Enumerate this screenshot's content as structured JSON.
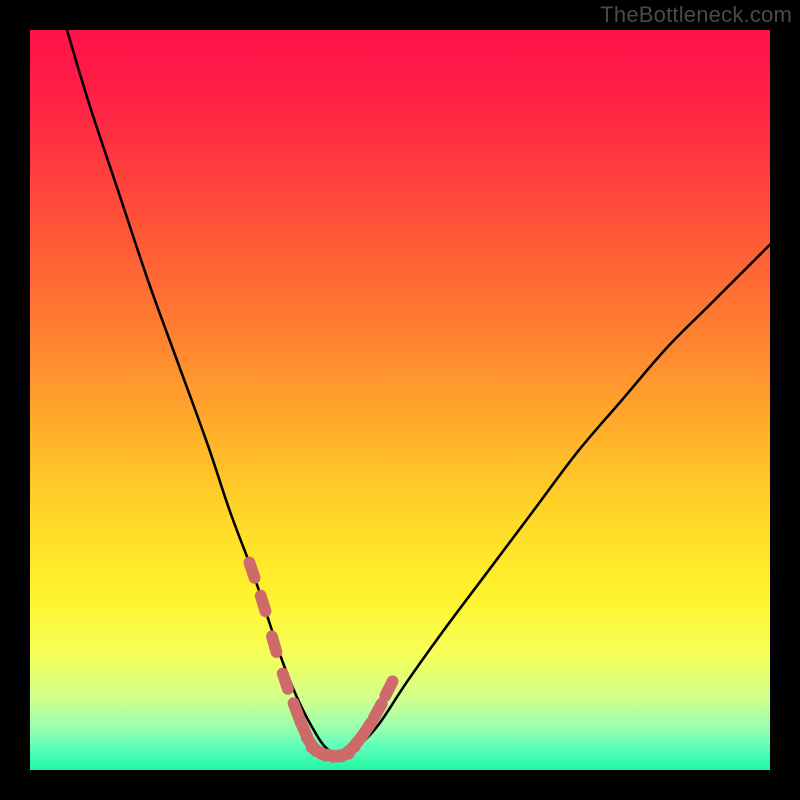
{
  "watermark": "TheBottleneck.com",
  "colors": {
    "background_black": "#000000",
    "gradient_stops": [
      {
        "offset": 0.0,
        "color": "#ff114a"
      },
      {
        "offset": 0.08,
        "color": "#ff1e46"
      },
      {
        "offset": 0.18,
        "color": "#ff3a3f"
      },
      {
        "offset": 0.3,
        "color": "#ff5e36"
      },
      {
        "offset": 0.42,
        "color": "#ff8330"
      },
      {
        "offset": 0.55,
        "color": "#ffb22a"
      },
      {
        "offset": 0.66,
        "color": "#ffd828"
      },
      {
        "offset": 0.76,
        "color": "#fff22c"
      },
      {
        "offset": 0.84,
        "color": "#f7ff55"
      },
      {
        "offset": 0.9,
        "color": "#d4ff8a"
      },
      {
        "offset": 0.94,
        "color": "#9effad"
      },
      {
        "offset": 0.97,
        "color": "#5cffba"
      },
      {
        "offset": 1.0,
        "color": "#20f5a3"
      }
    ],
    "curve": "#000000",
    "marker_fill": "#cf6a6a",
    "marker_stroke": "#cf6a6a"
  },
  "chart_data": {
    "type": "line",
    "title": "",
    "xlabel": "",
    "ylabel": "",
    "xlim": [
      0,
      100
    ],
    "ylim": [
      0,
      100
    ],
    "series": [
      {
        "name": "bottleneck-curve",
        "x": [
          5,
          8,
          12,
          16,
          20,
          24,
          27,
          30,
          32,
          34,
          36,
          38,
          40,
          42,
          44,
          47,
          51,
          56,
          62,
          68,
          74,
          80,
          86,
          92,
          98,
          100
        ],
        "y": [
          100,
          90,
          78,
          66,
          55,
          44,
          35,
          27,
          21,
          15,
          10,
          6,
          3,
          2,
          3,
          6,
          12,
          19,
          27,
          35,
          43,
          50,
          57,
          63,
          69,
          71
        ]
      }
    ],
    "markers": {
      "name": "highlight-dots",
      "points": [
        {
          "x": 30.0,
          "y": 27.0
        },
        {
          "x": 31.5,
          "y": 22.5
        },
        {
          "x": 33.0,
          "y": 17.0
        },
        {
          "x": 34.5,
          "y": 12.0
        },
        {
          "x": 36.0,
          "y": 8.0
        },
        {
          "x": 37.0,
          "y": 5.5
        },
        {
          "x": 38.0,
          "y": 3.5
        },
        {
          "x": 39.0,
          "y": 2.5
        },
        {
          "x": 40.5,
          "y": 2.0
        },
        {
          "x": 42.0,
          "y": 2.0
        },
        {
          "x": 43.0,
          "y": 2.5
        },
        {
          "x": 44.0,
          "y": 3.5
        },
        {
          "x": 45.5,
          "y": 5.5
        },
        {
          "x": 47.0,
          "y": 8.0
        },
        {
          "x": 48.5,
          "y": 11.0
        }
      ]
    }
  }
}
